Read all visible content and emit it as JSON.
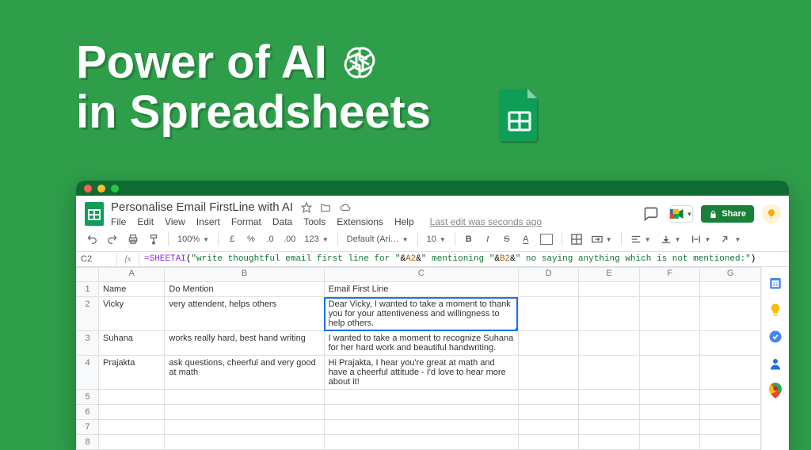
{
  "hero": {
    "line1": "Power of AI",
    "line2": "in Spreadsheets"
  },
  "window": {
    "doc_title": "Personalise Email FirstLine with AI",
    "menus": [
      "File",
      "Edit",
      "View",
      "Insert",
      "Format",
      "Data",
      "Tools",
      "Extensions",
      "Help"
    ],
    "last_edit": "Last edit was seconds ago",
    "share_label": "Share"
  },
  "toolbar": {
    "zoom": "100%",
    "currency_generic": "£",
    "percent": "%",
    "dec_dec": ".0",
    "dec_inc": ".00",
    "number_fmt": "123",
    "font": "Default (Ari…",
    "font_size": "10",
    "bold": "B",
    "italic": "I",
    "strike": "S",
    "text_color": "A"
  },
  "fx": {
    "cell": "C2",
    "label": "fx",
    "fn": "=SHEETAI",
    "open": "(",
    "s1": "\"write thoughtful email first line for \"",
    "amp1": "&",
    "r1": "A2",
    "amp2": "&",
    "s2": "\" mentioning \"",
    "amp3": "&",
    "r2": "B2",
    "amp4": "&",
    "s3": "\" no saying anything which is not mentioned:\"",
    "close": ")"
  },
  "columns": [
    "",
    "A",
    "B",
    "C",
    "D",
    "E",
    "F",
    "G"
  ],
  "headers": {
    "A": "Name",
    "B": "Do Mention",
    "C": "Email First Line"
  },
  "rows": [
    {
      "n": "1"
    },
    {
      "n": "2",
      "A": "Vicky",
      "B": "very attendent, helps others",
      "C": "Dear Vicky, I wanted to take a moment to thank you for your attentiveness and willingness to help others."
    },
    {
      "n": "3",
      "A": "Suhana",
      "B": "works really hard, best hand writing",
      "C": "I wanted to take a moment to recognize Suhana for her hard work and beautiful handwriting."
    },
    {
      "n": "4",
      "A": "Prajakta",
      "B": "ask questions, cheerful and very good at math",
      "C": "Hi Prajakta, I hear you're great at math and have a cheerful attitude - I'd love to hear more about it!"
    },
    {
      "n": "5"
    },
    {
      "n": "6"
    },
    {
      "n": "7"
    },
    {
      "n": "8"
    }
  ],
  "selected_cell": "C2"
}
